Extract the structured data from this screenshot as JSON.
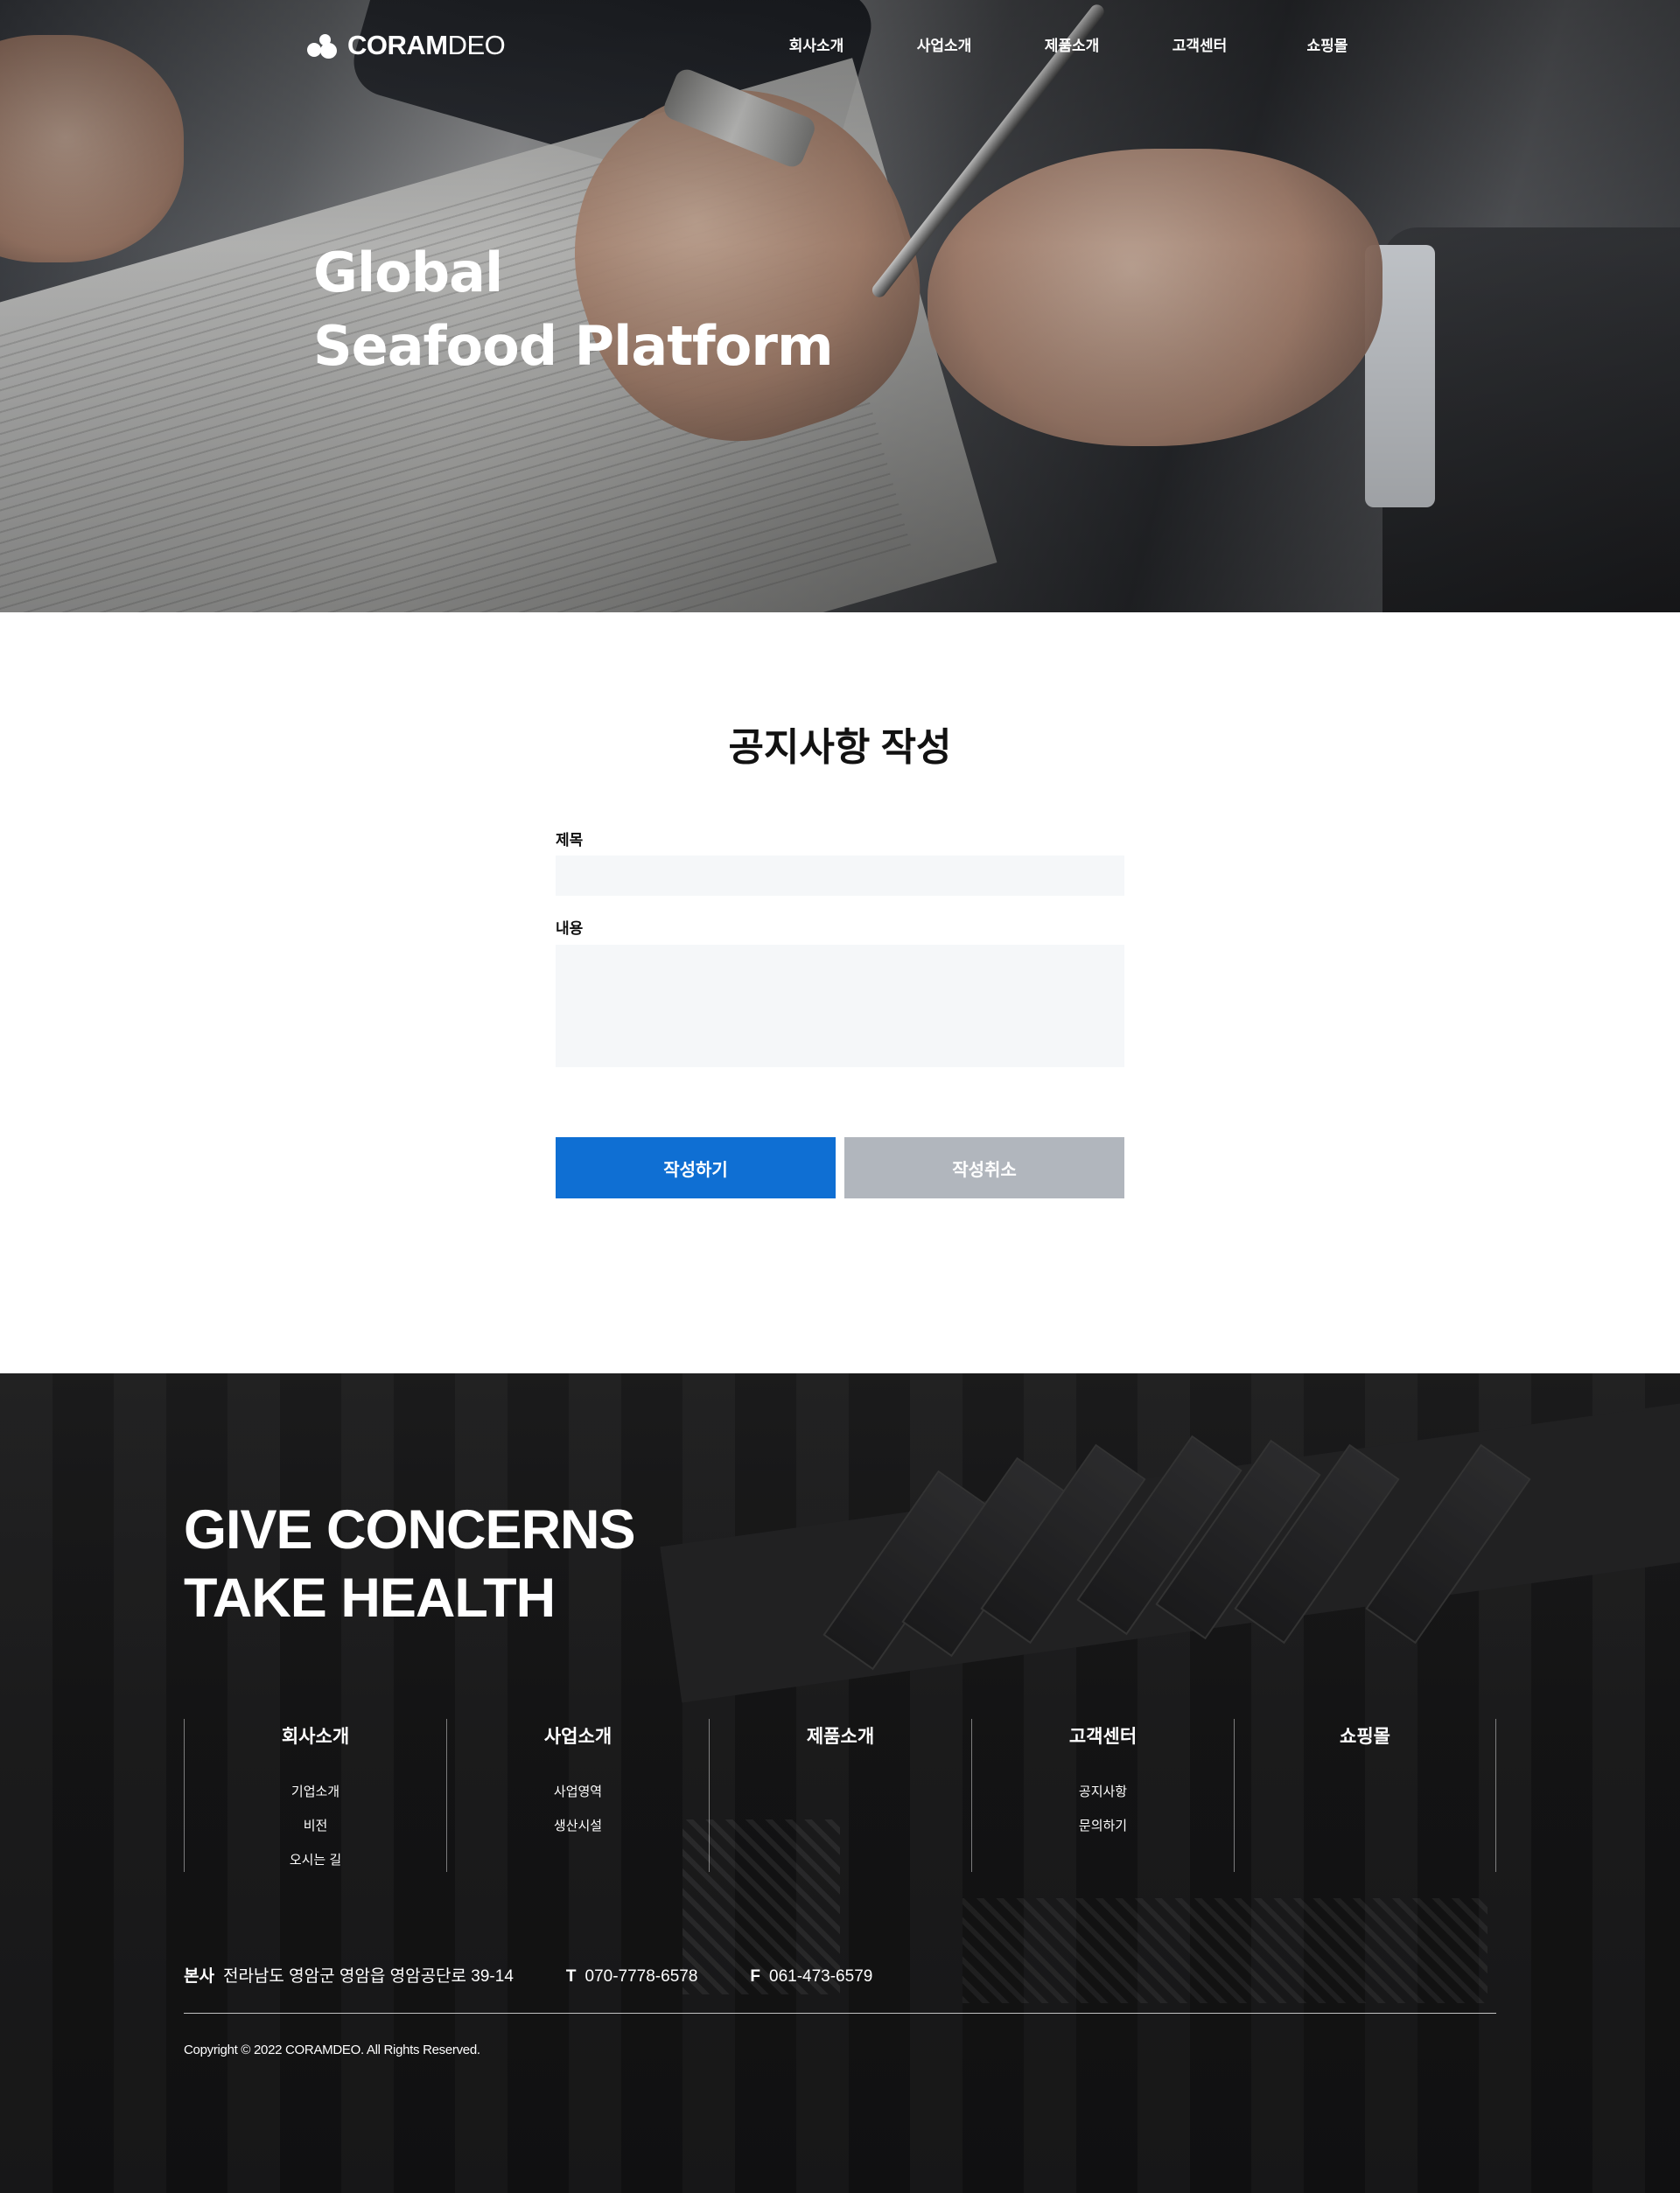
{
  "header": {
    "logo_bold": "CORAM",
    "logo_light": "DEO",
    "nav": [
      "회사소개",
      "사업소개",
      "제품소개",
      "고객센터",
      "쇼핑몰"
    ]
  },
  "hero": {
    "title_line1": "Global",
    "title_line2": "Seafood Platform"
  },
  "form": {
    "heading": "공지사항 작성",
    "title_label": "제목",
    "title_value": "",
    "content_label": "내용",
    "content_value": "",
    "submit_label": "작성하기",
    "cancel_label": "작성취소",
    "accent_color": "#0f6fd3",
    "cancel_color": "#b1b6bd"
  },
  "footer": {
    "slogan_line1": "GIVE CONCERNS",
    "slogan_line2": "TAKE HEALTH",
    "columns": [
      {
        "title": "회사소개",
        "links": [
          "기업소개",
          "비전",
          "오시는 길"
        ]
      },
      {
        "title": "사업소개",
        "links": [
          "사업영역",
          "생산시설"
        ]
      },
      {
        "title": "제품소개",
        "links": []
      },
      {
        "title": "고객센터",
        "links": [
          "공지사항",
          "문의하기"
        ]
      },
      {
        "title": "쇼핑몰",
        "links": []
      }
    ],
    "address_label": "본사",
    "address": "전라남도 영암군 영암읍 영암공단로 39-14",
    "tel_label": "T",
    "tel": "070-7778-6578",
    "fax_label": "F",
    "fax": "061-473-6579",
    "copyright": "Copyright © 2022 CORAMDEO. All Rights Reserved."
  }
}
